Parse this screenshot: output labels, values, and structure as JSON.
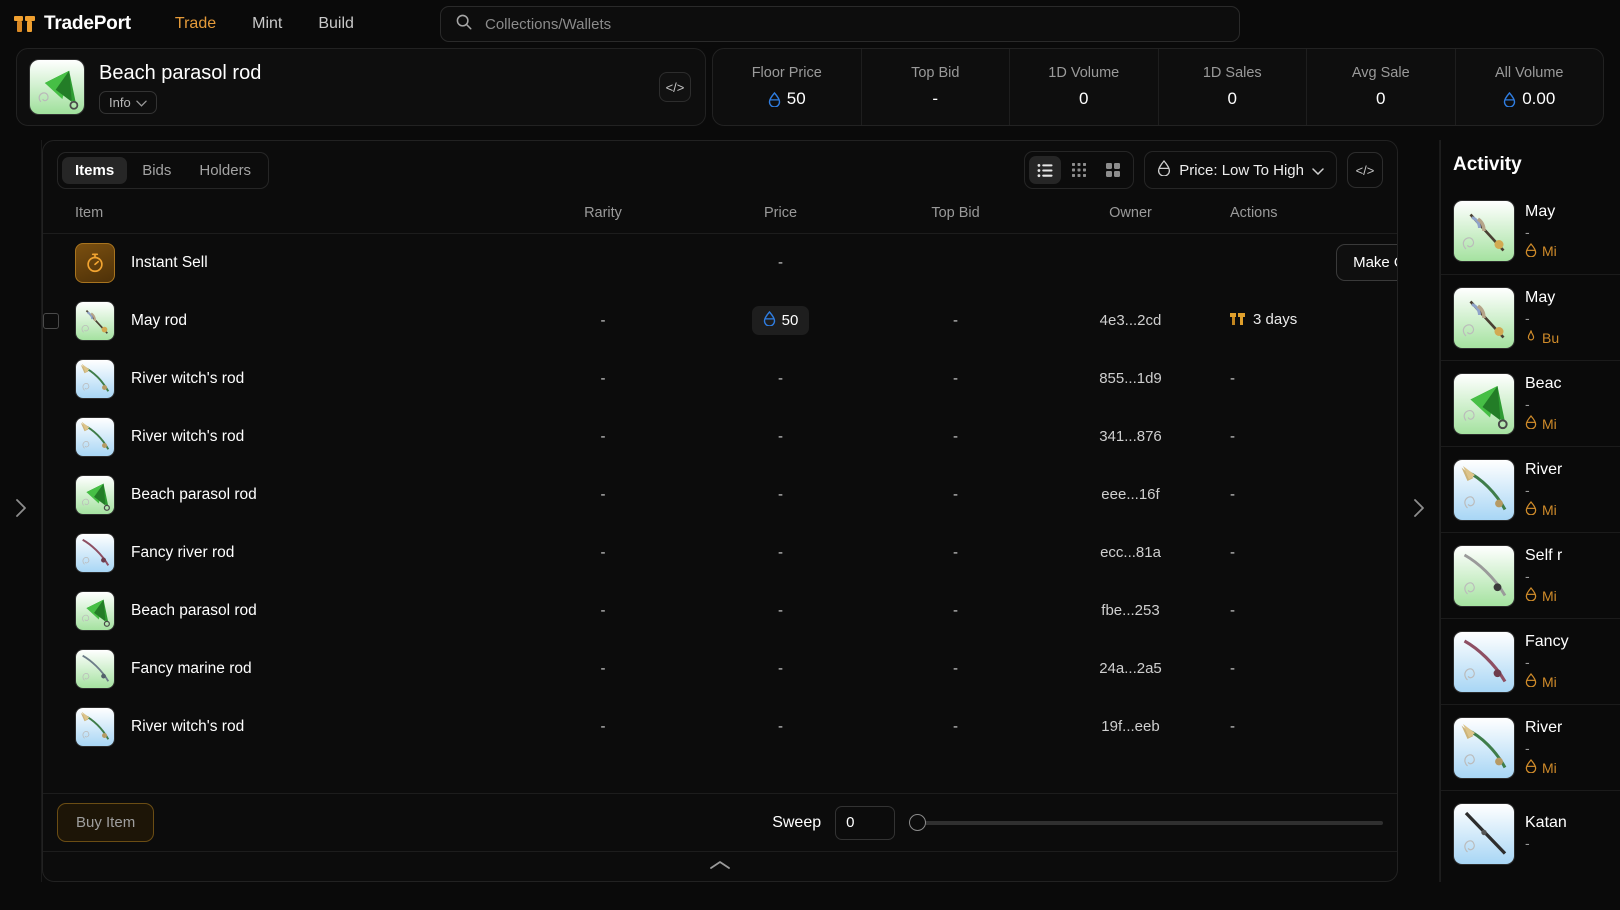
{
  "nav": {
    "brand": "TradePort",
    "links": [
      {
        "label": "Trade",
        "active": true
      },
      {
        "label": "Mint",
        "active": false
      },
      {
        "label": "Build",
        "active": false
      }
    ],
    "search_placeholder": "Collections/Wallets",
    "search_value": ""
  },
  "collection": {
    "title": "Beach parasol rod",
    "info_label": "Info",
    "code_icon": "</>"
  },
  "stats": [
    {
      "label": "Floor Price",
      "value": "50",
      "currency": true
    },
    {
      "label": "Top Bid",
      "value": "-",
      "currency": false
    },
    {
      "label": "1D Volume",
      "value": "0",
      "currency": false
    },
    {
      "label": "1D Sales",
      "value": "0",
      "currency": false
    },
    {
      "label": "Avg Sale",
      "value": "0",
      "currency": false
    },
    {
      "label": "All Volume",
      "value": "0.00",
      "currency": true
    }
  ],
  "toolbar": {
    "tabs": [
      {
        "label": "Items",
        "active": true
      },
      {
        "label": "Bids",
        "active": false
      },
      {
        "label": "Holders",
        "active": false
      }
    ],
    "views": [
      {
        "name": "list-view",
        "active": true
      },
      {
        "name": "small-grid-view",
        "active": false
      },
      {
        "name": "large-grid-view",
        "active": false
      }
    ],
    "sort_label": "Price: Low To High",
    "code_icon": "</>"
  },
  "table": {
    "headers": [
      "Item",
      "Rarity",
      "Price",
      "Top Bid",
      "Owner",
      "Actions"
    ],
    "rows": [
      {
        "kind": "instant-sell",
        "name": "Instant Sell",
        "rarity": "",
        "price": "-",
        "top_bid": "",
        "owner": "",
        "action": "Make Offer",
        "art": "instant"
      },
      {
        "kind": "item",
        "name": "May rod",
        "rarity": "-",
        "price": "50",
        "price_badge": true,
        "top_bid": "-",
        "owner": "4e3...2cd",
        "action": "3 days",
        "checkbox": true,
        "art": "may"
      },
      {
        "kind": "item",
        "name": "River witch's rod",
        "rarity": "-",
        "price": "-",
        "top_bid": "-",
        "owner": "855...1d9",
        "action": "-",
        "art": "river"
      },
      {
        "kind": "item",
        "name": "River witch's rod",
        "rarity": "-",
        "price": "-",
        "top_bid": "-",
        "owner": "341...876",
        "action": "-",
        "art": "river"
      },
      {
        "kind": "item",
        "name": "Beach parasol rod",
        "rarity": "-",
        "price": "-",
        "top_bid": "-",
        "owner": "eee...16f",
        "action": "-",
        "art": "parasol"
      },
      {
        "kind": "item",
        "name": "Fancy river rod",
        "rarity": "-",
        "price": "-",
        "top_bid": "-",
        "owner": "ecc...81a",
        "action": "-",
        "art": "fancyriver"
      },
      {
        "kind": "item",
        "name": "Beach parasol rod",
        "rarity": "-",
        "price": "-",
        "top_bid": "-",
        "owner": "fbe...253",
        "action": "-",
        "art": "parasol"
      },
      {
        "kind": "item",
        "name": "Fancy marine rod",
        "rarity": "-",
        "price": "-",
        "top_bid": "-",
        "owner": "24a...2a5",
        "action": "-",
        "art": "marine"
      },
      {
        "kind": "item",
        "name": "River witch's rod",
        "rarity": "-",
        "price": "-",
        "top_bid": "-",
        "owner": "19f...eeb",
        "action": "-",
        "art": "river"
      }
    ]
  },
  "footer": {
    "buy_label": "Buy Item",
    "sweep_label": "Sweep",
    "sweep_value": "0"
  },
  "activity": {
    "title": "Activity",
    "rows": [
      {
        "name": "May ",
        "sub": "-",
        "kind": "Mi",
        "art": "may"
      },
      {
        "name": "May ",
        "sub": "-",
        "kind": "Bu",
        "art": "may"
      },
      {
        "name": "Beac",
        "sub": "-",
        "kind": "Mi",
        "art": "parasol"
      },
      {
        "name": "River",
        "sub": "-",
        "kind": "Mi",
        "art": "river"
      },
      {
        "name": "Self r",
        "sub": "-",
        "kind": "Mi",
        "art": "self"
      },
      {
        "name": "Fancy",
        "sub": "-",
        "kind": "Mi",
        "art": "fancyriver"
      },
      {
        "name": "River",
        "sub": "-",
        "kind": "Mi",
        "art": "river"
      },
      {
        "name": "Katan",
        "sub": "-",
        "kind": "",
        "art": "katana"
      }
    ]
  },
  "colors": {
    "accent": "#e59b3a",
    "aptos": "#2f7de1",
    "activity_kind": "#cf8b2a"
  }
}
